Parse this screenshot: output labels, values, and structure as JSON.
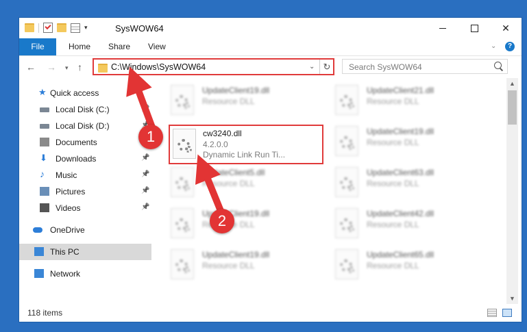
{
  "window": {
    "title": "SysWOW64"
  },
  "ribbon": {
    "tabs": [
      "File",
      "Home",
      "Share",
      "View"
    ]
  },
  "nav": {
    "address": "C:\\Windows\\SysWOW64",
    "search_placeholder": "Search SysWOW64"
  },
  "sidebar": {
    "items": [
      {
        "label": "Quick access",
        "icon": "star-icon",
        "pinned": false
      },
      {
        "label": "Local Disk (C:)",
        "icon": "drive-icon",
        "pinned": true
      },
      {
        "label": "Local Disk (D:)",
        "icon": "drive-icon",
        "pinned": true
      },
      {
        "label": "Documents",
        "icon": "documents-icon",
        "pinned": true
      },
      {
        "label": "Downloads",
        "icon": "download-icon",
        "pinned": true
      },
      {
        "label": "Music",
        "icon": "music-icon",
        "pinned": true
      },
      {
        "label": "Pictures",
        "icon": "pictures-icon",
        "pinned": true
      },
      {
        "label": "Videos",
        "icon": "videos-icon",
        "pinned": true
      },
      {
        "label": "OneDrive",
        "icon": "onedrive-icon",
        "pinned": false
      },
      {
        "label": "This PC",
        "icon": "computer-icon",
        "pinned": false,
        "selected": true
      },
      {
        "label": "Network",
        "icon": "network-icon",
        "pinned": false
      }
    ]
  },
  "files": {
    "col1": [
      {
        "name": "UpdateClient19.dll",
        "sub": "Resource DLL"
      },
      {
        "name": "cw3240.dll",
        "version": "4.2.0.0",
        "desc": "Dynamic Link Run Ti..."
      },
      {
        "name": "UpdateClient5.dll",
        "sub": "Resource DLL"
      },
      {
        "name": "UpdateClient19.dll",
        "sub": "Resource DLL"
      },
      {
        "name": "UpdateClient19.dll",
        "sub": "Resource DLL"
      }
    ],
    "col2": [
      {
        "name": "UpdateClient21.dll",
        "sub": "Resource DLL"
      },
      {
        "name": "UpdateClient19.dll",
        "sub": "Resource DLL"
      },
      {
        "name": "UpdateClient63.dll",
        "sub": "Resource DLL"
      },
      {
        "name": "UpdateClient42.dll",
        "sub": "Resource DLL"
      },
      {
        "name": "UpdateClient65.dll",
        "sub": "Resource DLL"
      }
    ]
  },
  "status": {
    "items_count": "118 items"
  },
  "annotations": {
    "step1": "1",
    "step2": "2",
    "color": "#e23434"
  }
}
